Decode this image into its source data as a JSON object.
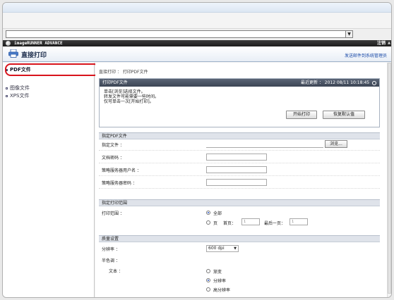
{
  "browser": {
    "address_value": "",
    "dropdown_glyph": "▼"
  },
  "app": {
    "title": "imageRUNNER ADVANCE",
    "logout": "注销",
    "scroll_glyph": "▲"
  },
  "header": {
    "page_title": "直接打印",
    "admin_link": "发送邮件到系统管理员"
  },
  "sidebar": {
    "items": [
      {
        "label": "PDF文件"
      },
      {
        "label": "图像文件"
      },
      {
        "label": "XPS文件"
      }
    ]
  },
  "breadcrumb": "直接打印 ： 打印PDF文件",
  "print_panel": {
    "title": "打印PDF文件",
    "updated": "最近更新 ： 2012 08/11 10:18:45",
    "message_lines": [
      "单击[浏览]选择文件。",
      "转发文件可能需要一些时间。",
      "仅可单击一次[开始打印]。"
    ],
    "start_button": "开始打印",
    "restore_button": "恢复默认值"
  },
  "file_section": {
    "title": "指定PDF文件",
    "rows": [
      {
        "label": "指定文件 ："
      },
      {
        "label": "文档密码 ："
      },
      {
        "label": "策略服务器用户名 ："
      },
      {
        "label": "策略服务器密码 ："
      }
    ],
    "browse_button": "浏览..."
  },
  "range_section": {
    "title": "指定打印范围",
    "label": "打印范围 ：",
    "option_all": "全部",
    "option_pages": "页",
    "first_page_label": "首页：",
    "first_page_placeholder": "1",
    "last_page_label": "最后一页：",
    "last_page_placeholder": "1",
    "selected": "all"
  },
  "quality_section": {
    "title": "质量设置",
    "resolution_label": "分辨率 ：",
    "resolution_value": "600 dpi",
    "halftone_label": "半色调 ：",
    "text_label": "文本 ：",
    "text_options": [
      "渐变",
      "分辨率",
      "高分辨率"
    ],
    "text_selected": "分辨率"
  }
}
